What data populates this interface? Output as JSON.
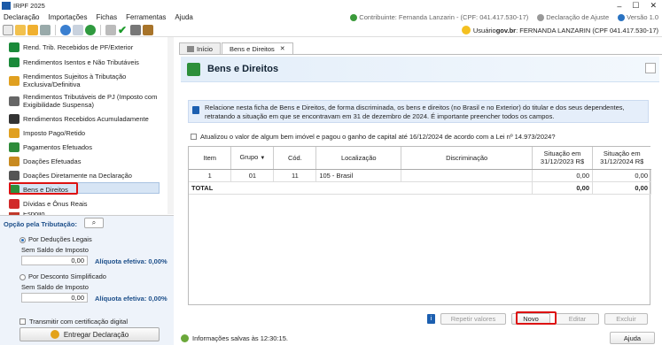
{
  "window": {
    "title": "IRPF 2025"
  },
  "menu": {
    "items": [
      "Declaração",
      "Importações",
      "Fichas",
      "Ferramentas",
      "Ajuda"
    ]
  },
  "status_top": {
    "contribuinte": "Contribuinte: Fernanda Lanzarin - (CPF: 041.417.530-17)",
    "declaracao": "Declaração de Ajuste",
    "versao": "Versão 1.0"
  },
  "user": {
    "prefix": "Usuário ",
    "gov": "gov.br",
    "suffix": ": FERNANDA LANZARIN (CPF 041.417.530-17)"
  },
  "sidebar": {
    "items": [
      {
        "label": "Rend. Trib. Recebidos de PF/Exterior",
        "color": "#1b8a3a"
      },
      {
        "label": "Rendimentos Isentos e Não Tributáveis",
        "color": "#1b8a3a"
      },
      {
        "label": "Rendimentos Sujeitos à Tributação Exclusiva/Definitiva",
        "color": "#e0a020"
      },
      {
        "label": "Rendimentos Tributáveis de PJ (Imposto com Exigibilidade Suspensa)",
        "color": "#666"
      },
      {
        "label": "Rendimentos Recebidos Acumuladamente",
        "color": "#333"
      },
      {
        "label": "Imposto Pago/Retido",
        "color": "#e0a020"
      },
      {
        "label": "Pagamentos Efetuados",
        "color": "#2e8b3a"
      },
      {
        "label": "Doações Efetuadas",
        "color": "#c88a20"
      },
      {
        "label": "Doações Diretamente na Declaração",
        "color": "#555"
      },
      {
        "label": "Bens e Direitos",
        "color": "#2d8f3a"
      },
      {
        "label": "Dívidas e Ônus Reais",
        "color": "#d12a2a"
      },
      {
        "label": "Espólio",
        "color": "#c0392b"
      }
    ]
  },
  "opcao": {
    "title": "Opção pela Tributação:",
    "deducoes": "Por Deduções Legais",
    "sem_saldo_1": "Sem Saldo de Imposto",
    "valor_1": "0,00",
    "aliquota_1": "Alíquota efetiva: 0,00%",
    "simplificado": "Por Desconto Simplificado",
    "sem_saldo_2": "Sem Saldo de Imposto",
    "valor_2": "0,00",
    "aliquota_2": "Alíquota efetiva: 0,00%",
    "transmitir": "Transmitir com certificação digital",
    "entregar": "Entregar Declaração"
  },
  "tabs": {
    "inicio": "Início",
    "bens": "Bens e Direitos"
  },
  "page": {
    "title": "Bens e Direitos"
  },
  "info": {
    "text": "Relacione nesta ficha de Bens e Direitos, de forma discriminada, os bens e direitos (no Brasil e no Exterior) do titular e dos seus dependentes, retratando a situação em que se encontravam em 31 de dezembro de 2024. É importante preencher todos os campos."
  },
  "checkbox": {
    "label": "Atualizou o valor de algum bem imóvel e pagou o ganho de capital até 16/12/2024 de acordo com a Lei nº 14.973/2024?"
  },
  "table": {
    "headers": {
      "item": "Item",
      "grupo": "Grupo",
      "cod": "Cód.",
      "localizacao": "Localização",
      "discriminacao": "Discriminação",
      "sit2023": "Situação em 31/12/2023 R$",
      "sit2024": "Situação em 31/12/2024 R$"
    },
    "rows": [
      {
        "item": "1",
        "grupo": "01",
        "cod": "11",
        "localizacao": "105 - Brasil",
        "discriminacao": "",
        "sit2023": "0,00",
        "sit2024": "0,00"
      }
    ],
    "total": {
      "label": "TOTAL",
      "sit2023": "0,00",
      "sit2024": "0,00"
    }
  },
  "buttons": {
    "repetir": "Repetir valores",
    "novo": "Novo",
    "editar": "Editar",
    "excluir": "Excluir",
    "ajuda": "Ajuda"
  },
  "statusbar": {
    "text": "Informações salvas às 12:30:15."
  }
}
